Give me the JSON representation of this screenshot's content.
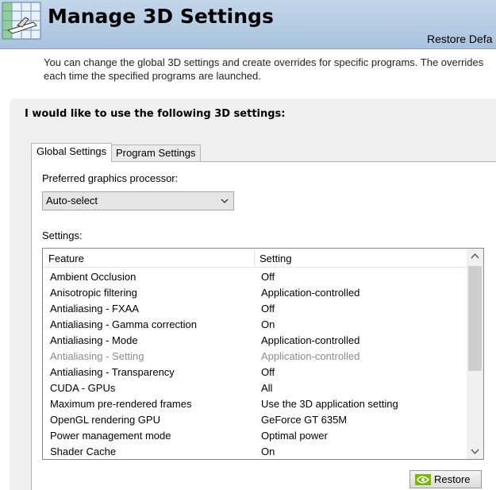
{
  "header": {
    "title": "Manage 3D Settings",
    "restore_link": "Restore Defa"
  },
  "description": {
    "line1": "You can change the global 3D settings and create overrides for specific programs. The overrides",
    "line2": "each time the specified programs are launched."
  },
  "panel": {
    "heading": "I would like to use the following 3D settings:"
  },
  "tabs": [
    {
      "label": "Global Settings",
      "active": true
    },
    {
      "label": "Program Settings",
      "active": false
    }
  ],
  "processor": {
    "label": "Preferred graphics processor:",
    "value": "Auto-select"
  },
  "settings": {
    "label": "Settings:",
    "columns": [
      "Feature",
      "Setting"
    ],
    "rows": [
      {
        "feature": "Ambient Occlusion",
        "setting": "Off",
        "disabled": false
      },
      {
        "feature": "Anisotropic filtering",
        "setting": "Application-controlled",
        "disabled": false
      },
      {
        "feature": "Antialiasing - FXAA",
        "setting": "Off",
        "disabled": false
      },
      {
        "feature": "Antialiasing - Gamma correction",
        "setting": "On",
        "disabled": false
      },
      {
        "feature": "Antialiasing - Mode",
        "setting": "Application-controlled",
        "disabled": false
      },
      {
        "feature": "Antialiasing - Setting",
        "setting": "Application-controlled",
        "disabled": true
      },
      {
        "feature": "Antialiasing - Transparency",
        "setting": "Off",
        "disabled": false
      },
      {
        "feature": "CUDA - GPUs",
        "setting": "All",
        "disabled": false
      },
      {
        "feature": "Maximum pre-rendered frames",
        "setting": "Use the 3D application setting",
        "disabled": false
      },
      {
        "feature": "OpenGL rendering GPU",
        "setting": "GeForce GT 635M",
        "disabled": false
      },
      {
        "feature": "Power management mode",
        "setting": "Optimal power",
        "disabled": false
      },
      {
        "feature": "Shader Cache",
        "setting": "On",
        "disabled": false
      }
    ]
  },
  "restore_button": {
    "label": "Restore",
    "icon": "nvidia-icon"
  },
  "colors": {
    "header_bg": "#b7cde5",
    "nvidia_green": "#76b900",
    "disabled_text": "#8a8a8a"
  }
}
